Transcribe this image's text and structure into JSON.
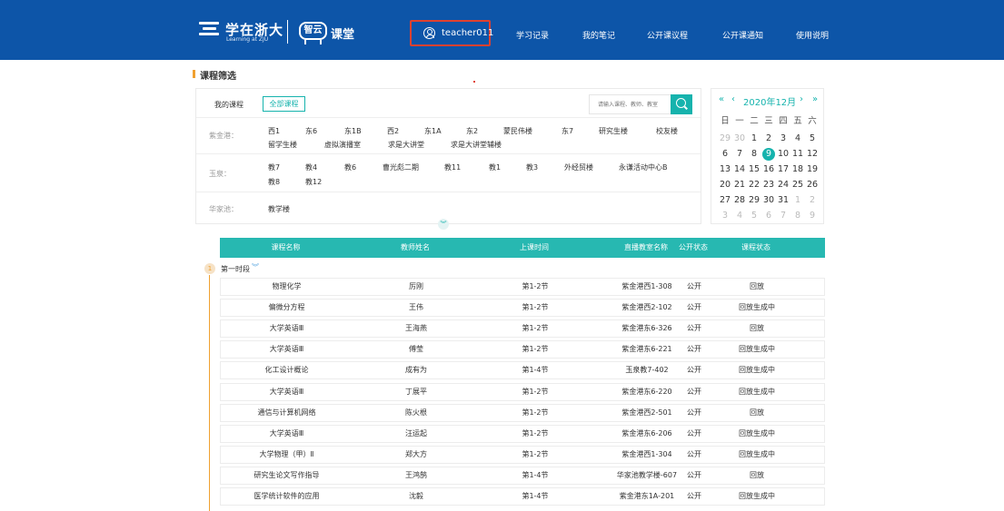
{
  "header": {
    "logo_cn": "学在浙大",
    "logo_en": "Learning at ZJU",
    "zhiyun": "智云",
    "ketang": "课堂",
    "user": "teacher011",
    "nav": [
      "学习记录",
      "我的笔记",
      "公开课议程",
      "公开课通知",
      "使用说明"
    ]
  },
  "section_title": "课程筛选",
  "filter": {
    "my_courses": "我的课程",
    "all_courses": "全部课程",
    "search_placeholder": "请输入课程、教师、教室",
    "campuses": [
      {
        "name": "紫金港：",
        "buildings": [
          "西1",
          "东6",
          "东1B",
          "西2",
          "东1A",
          "东2",
          "蒙民伟楼",
          "东7",
          "研究生楼",
          "校友楼",
          "留学生楼",
          "虚拟演播室",
          "求是大讲堂",
          "求是大讲堂辅楼"
        ]
      },
      {
        "name": "玉泉：",
        "buildings": [
          "教7",
          "教4",
          "教6",
          "曹光彪二期",
          "教11",
          "教1",
          "教3",
          "外经贸楼",
          "永谦活动中心B",
          "教8",
          "教12"
        ]
      },
      {
        "name": "华家池：",
        "buildings": [
          "教学楼"
        ]
      }
    ]
  },
  "calendar": {
    "title": "2020年12月",
    "weekdays": [
      "日",
      "一",
      "二",
      "三",
      "四",
      "五",
      "六"
    ],
    "days": [
      [
        "29",
        "30",
        "1",
        "2",
        "3",
        "4",
        "5"
      ],
      [
        "6",
        "7",
        "8",
        "9",
        "10",
        "11",
        "12"
      ],
      [
        "13",
        "14",
        "15",
        "16",
        "17",
        "18",
        "19"
      ],
      [
        "20",
        "21",
        "22",
        "23",
        "24",
        "25",
        "26"
      ],
      [
        "27",
        "28",
        "29",
        "30",
        "31",
        "1",
        "2"
      ],
      [
        "3",
        "4",
        "5",
        "6",
        "7",
        "8",
        "9"
      ]
    ],
    "selected": "9"
  },
  "table": {
    "headers": [
      "课程名称",
      "教师姓名",
      "上课时间",
      "直播教室名称",
      "公开状态",
      "课程状态"
    ],
    "period_index": "1",
    "period_label": "第一时段",
    "rows": [
      [
        "物理化学",
        "厉刚",
        "第1-2节",
        "紫金港西1-308",
        "公开",
        "回放"
      ],
      [
        "偏微分方程",
        "王伟",
        "第1-2节",
        "紫金港西2-102",
        "公开",
        "回放生成中"
      ],
      [
        "大学英语Ⅲ",
        "王海燕",
        "第1-2节",
        "紫金港东6-326",
        "公开",
        "回放"
      ],
      [
        "大学英语Ⅲ",
        "傅莹",
        "第1-2节",
        "紫金港东6-221",
        "公开",
        "回放生成中"
      ],
      [
        "化工设计概论",
        "成有为",
        "第1-4节",
        "玉泉教7-402",
        "公开",
        "回放生成中"
      ],
      [
        "大学英语Ⅲ",
        "丁展平",
        "第1-2节",
        "紫金港东6-220",
        "公开",
        "回放生成中"
      ],
      [
        "通信与计算机网络",
        "陈火根",
        "第1-2节",
        "紫金港西2-501",
        "公开",
        "回放"
      ],
      [
        "大学英语Ⅲ",
        "汪运起",
        "第1-2节",
        "紫金港东6-206",
        "公开",
        "回放生成中"
      ],
      [
        "大学物理（甲）Ⅱ",
        "郑大方",
        "第1-2节",
        "紫金港西1-304",
        "公开",
        "回放生成中"
      ],
      [
        "研究生论文写作指导",
        "王鸿鹄",
        "第1-4节",
        "华家池教学楼-607",
        "公开",
        "回放"
      ],
      [
        "医学统计软件的应用",
        "沈毅",
        "第1-4节",
        "紫金港东1A-201",
        "公开",
        "回放生成中"
      ]
    ]
  },
  "colors": {
    "header_bg": "#0d55a8",
    "accent": "#16b3ad",
    "table_header": "#27b8b1",
    "highlight_border": "#e0412f",
    "period_accent": "#f0a030"
  }
}
